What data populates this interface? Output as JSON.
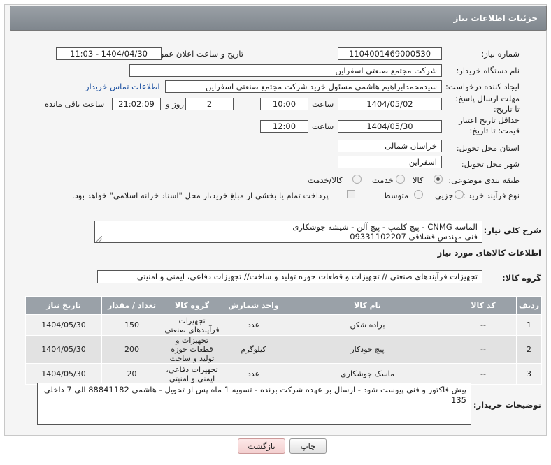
{
  "header": {
    "title": "جزئیات اطلاعات نیاز"
  },
  "form": {
    "need_number_label": "شماره نیاز:",
    "need_number": "1104001469000530",
    "announce_label": "تاریخ و ساعت اعلان عمومی:",
    "announce_value": "1404/04/30 - 11:03",
    "buyer_org_label": "نام دستگاه خریدار:",
    "buyer_org": "شرکت مجتمع صنعتی اسفراین",
    "creator_label": "ایجاد کننده درخواست:",
    "creator": "سیدمحمدابراهیم هاشمی مسئول خرید شرکت مجتمع صنعتی اسفراین",
    "contact_link": "اطلاعات تماس خریدار",
    "reply_deadline_label": "مهلت ارسال پاسخ: تا تاریخ:",
    "reply_date": "1404/05/02",
    "time_label": "ساعت",
    "reply_time": "10:00",
    "days_value": "2",
    "days_label": "روز و",
    "remaining_time": "21:02:09",
    "remaining_label": "ساعت باقی مانده",
    "price_validity_label": "حداقل تاریخ اعتبار قیمت: تا تاریخ:",
    "validity_date": "1404/05/30",
    "validity_time": "12:00",
    "province_label": "استان محل تحویل:",
    "province": "خراسان شمالی",
    "city_label": "شهر محل تحویل:",
    "city": "اسفراین",
    "category_label": "طبقه بندی موضوعی:",
    "category_options": [
      "کالا",
      "خدمت",
      "کالا/خدمت"
    ],
    "process_label": "نوع فرآیند خرید :",
    "process_options": [
      "جزیی",
      "متوسط"
    ],
    "payment_note": "پرداخت تمام یا بخشی از مبلغ خرید،از محل \"اسناد خزانه اسلامی\" خواهد بود.",
    "description_label": "شرح کلی نیاز:",
    "description_line1": "الماسه CNMG - پیچ کلمپ - پیچ آلن - شیشه جوشکاری",
    "description_line2": "فنی مهندس قشلاقی 09331102207",
    "goods_info_title": "اطلاعات کالاهای مورد نیاز",
    "goods_group_label": "گروه کالا:",
    "goods_group": "تجهیزات فرآیندهای صنعتی // تجهیزات و قطعات حوزه تولید و ساخت// تجهیزات دفاعی، ایمنی و امنیتی"
  },
  "table": {
    "headers": [
      "ردیف",
      "کد کالا",
      "نام کالا",
      "واحد شمارش",
      "گروه کالا",
      "تعداد / مقدار",
      "تاریخ نیاز"
    ],
    "rows": [
      {
        "idx": "1",
        "code": "--",
        "name": "براده شکن",
        "unit": "عدد",
        "group": "تجهیزات فرآیندهای صنعتی",
        "qty": "150",
        "date": "1404/05/30"
      },
      {
        "idx": "2",
        "code": "--",
        "name": "پیچ خودکار",
        "unit": "کیلوگرم",
        "group": "تجهیزات و قطعات حوزه تولید و ساخت",
        "qty": "200",
        "date": "1404/05/30"
      },
      {
        "idx": "3",
        "code": "--",
        "name": "ماسک جوشکاری",
        "unit": "عدد",
        "group": "تجهیزات دفاعی، ایمنی و امنیتی",
        "qty": "20",
        "date": "1404/05/30"
      }
    ]
  },
  "buyer_notes": {
    "label": "توضیحات خریدار:",
    "text": "پیش فاکتور و فنی پیوست شود - ارسال بر عهده شرکت برنده - تسویه 1 ماه پس از تحویل - هاشمی 88841182 الی 7 داخلی 135"
  },
  "buttons": {
    "print": "چاپ",
    "back": "بازگشت"
  },
  "colors": {
    "header_bg": "#8a9097",
    "link": "#1a4fa0",
    "table_header": "#9aa1a8"
  }
}
